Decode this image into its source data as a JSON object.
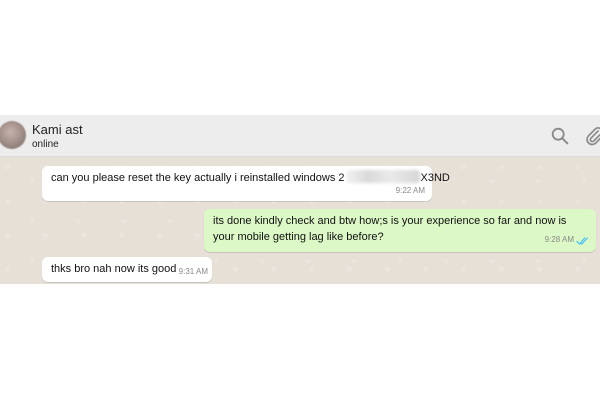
{
  "header": {
    "contact_name": "Kami ast",
    "status": "online",
    "icons": [
      "search-icon",
      "attach-icon"
    ]
  },
  "messages": [
    {
      "direction": "incoming",
      "text_before": "can you please reset the key actually i reinstalled windows 2",
      "text_after": "X3ND",
      "time": "9:22 AM"
    },
    {
      "direction": "outgoing",
      "text": "its done kindly check and btw how;s is your experience so far and now is your mobile getting lag like before?",
      "time": "9:28 AM",
      "read_receipt": "double-blue-tick"
    },
    {
      "direction": "incoming",
      "text": "thks bro nah now its good",
      "time": "9:31 AM"
    }
  ],
  "colors": {
    "header_bg": "#ededed",
    "chat_bg": "#e6e0d6",
    "incoming_bubble": "#ffffff",
    "outgoing_bubble": "#dcf8c6",
    "read_tick": "#4fc3f7"
  }
}
